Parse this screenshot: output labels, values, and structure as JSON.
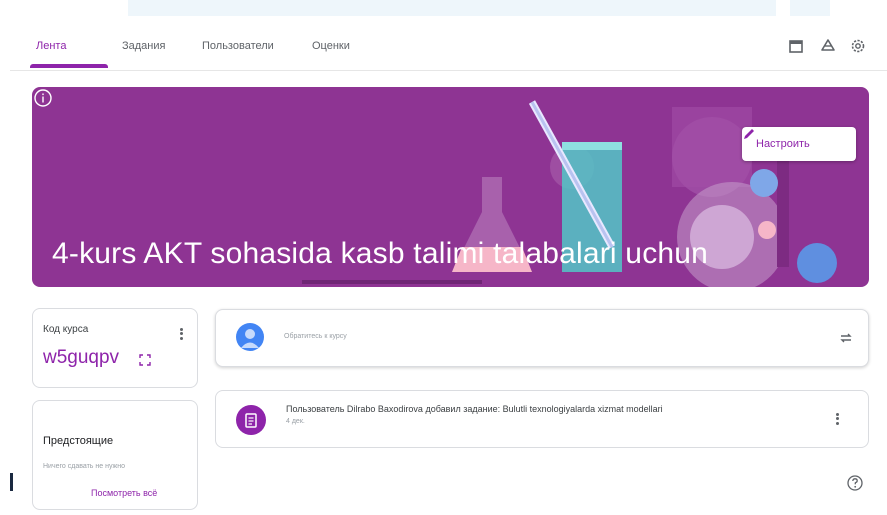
{
  "nav": {
    "tabs": [
      {
        "label": "Лента",
        "active": true
      },
      {
        "label": "Задания",
        "active": false
      },
      {
        "label": "Пользователи",
        "active": false
      },
      {
        "label": "Оценки",
        "active": false
      }
    ],
    "icons": [
      "calendar-icon",
      "drive-icon",
      "settings-icon"
    ]
  },
  "banner": {
    "title": "4-kurs AKT sohasida kasb talimi talabalari uchun",
    "customize_label": "Настроить",
    "background_color": "#8e3493"
  },
  "class_code": {
    "label": "Код курса",
    "value": "w5guqpv"
  },
  "upcoming": {
    "title": "Предстоящие",
    "empty_text": "Ничего сдавать не нужно",
    "view_all": "Посмотреть всё"
  },
  "composer": {
    "placeholder": "Обратитесь к курсу"
  },
  "stream": [
    {
      "text": "Пользователь Dilrabo Baxodirova добавил задание: Bulutli texnologiyalarda xizmat modellari",
      "date": "4 дек."
    }
  ],
  "colors": {
    "accent": "#8e24aa",
    "avatar": "#4285f4"
  }
}
